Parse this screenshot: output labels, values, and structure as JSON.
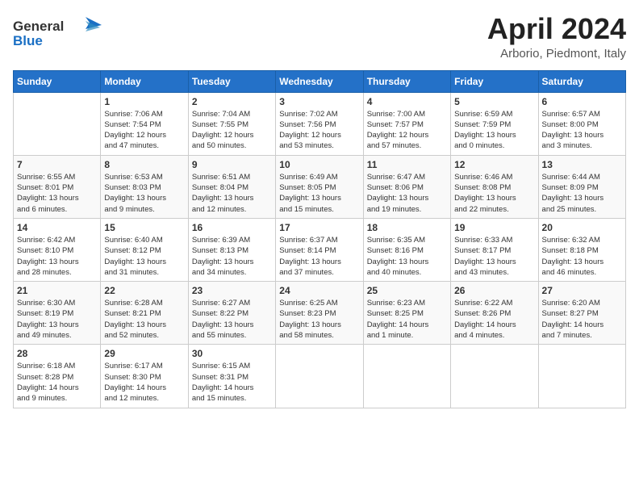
{
  "header": {
    "logo_general": "General",
    "logo_blue": "Blue",
    "title": "April 2024",
    "location": "Arborio, Piedmont, Italy"
  },
  "days_of_week": [
    "Sunday",
    "Monday",
    "Tuesday",
    "Wednesday",
    "Thursday",
    "Friday",
    "Saturday"
  ],
  "weeks": [
    [
      {
        "day": "",
        "info": ""
      },
      {
        "day": "1",
        "info": "Sunrise: 7:06 AM\nSunset: 7:54 PM\nDaylight: 12 hours\nand 47 minutes."
      },
      {
        "day": "2",
        "info": "Sunrise: 7:04 AM\nSunset: 7:55 PM\nDaylight: 12 hours\nand 50 minutes."
      },
      {
        "day": "3",
        "info": "Sunrise: 7:02 AM\nSunset: 7:56 PM\nDaylight: 12 hours\nand 53 minutes."
      },
      {
        "day": "4",
        "info": "Sunrise: 7:00 AM\nSunset: 7:57 PM\nDaylight: 12 hours\nand 57 minutes."
      },
      {
        "day": "5",
        "info": "Sunrise: 6:59 AM\nSunset: 7:59 PM\nDaylight: 13 hours\nand 0 minutes."
      },
      {
        "day": "6",
        "info": "Sunrise: 6:57 AM\nSunset: 8:00 PM\nDaylight: 13 hours\nand 3 minutes."
      }
    ],
    [
      {
        "day": "7",
        "info": "Sunrise: 6:55 AM\nSunset: 8:01 PM\nDaylight: 13 hours\nand 6 minutes."
      },
      {
        "day": "8",
        "info": "Sunrise: 6:53 AM\nSunset: 8:03 PM\nDaylight: 13 hours\nand 9 minutes."
      },
      {
        "day": "9",
        "info": "Sunrise: 6:51 AM\nSunset: 8:04 PM\nDaylight: 13 hours\nand 12 minutes."
      },
      {
        "day": "10",
        "info": "Sunrise: 6:49 AM\nSunset: 8:05 PM\nDaylight: 13 hours\nand 15 minutes."
      },
      {
        "day": "11",
        "info": "Sunrise: 6:47 AM\nSunset: 8:06 PM\nDaylight: 13 hours\nand 19 minutes."
      },
      {
        "day": "12",
        "info": "Sunrise: 6:46 AM\nSunset: 8:08 PM\nDaylight: 13 hours\nand 22 minutes."
      },
      {
        "day": "13",
        "info": "Sunrise: 6:44 AM\nSunset: 8:09 PM\nDaylight: 13 hours\nand 25 minutes."
      }
    ],
    [
      {
        "day": "14",
        "info": "Sunrise: 6:42 AM\nSunset: 8:10 PM\nDaylight: 13 hours\nand 28 minutes."
      },
      {
        "day": "15",
        "info": "Sunrise: 6:40 AM\nSunset: 8:12 PM\nDaylight: 13 hours\nand 31 minutes."
      },
      {
        "day": "16",
        "info": "Sunrise: 6:39 AM\nSunset: 8:13 PM\nDaylight: 13 hours\nand 34 minutes."
      },
      {
        "day": "17",
        "info": "Sunrise: 6:37 AM\nSunset: 8:14 PM\nDaylight: 13 hours\nand 37 minutes."
      },
      {
        "day": "18",
        "info": "Sunrise: 6:35 AM\nSunset: 8:16 PM\nDaylight: 13 hours\nand 40 minutes."
      },
      {
        "day": "19",
        "info": "Sunrise: 6:33 AM\nSunset: 8:17 PM\nDaylight: 13 hours\nand 43 minutes."
      },
      {
        "day": "20",
        "info": "Sunrise: 6:32 AM\nSunset: 8:18 PM\nDaylight: 13 hours\nand 46 minutes."
      }
    ],
    [
      {
        "day": "21",
        "info": "Sunrise: 6:30 AM\nSunset: 8:19 PM\nDaylight: 13 hours\nand 49 minutes."
      },
      {
        "day": "22",
        "info": "Sunrise: 6:28 AM\nSunset: 8:21 PM\nDaylight: 13 hours\nand 52 minutes."
      },
      {
        "day": "23",
        "info": "Sunrise: 6:27 AM\nSunset: 8:22 PM\nDaylight: 13 hours\nand 55 minutes."
      },
      {
        "day": "24",
        "info": "Sunrise: 6:25 AM\nSunset: 8:23 PM\nDaylight: 13 hours\nand 58 minutes."
      },
      {
        "day": "25",
        "info": "Sunrise: 6:23 AM\nSunset: 8:25 PM\nDaylight: 14 hours\nand 1 minute."
      },
      {
        "day": "26",
        "info": "Sunrise: 6:22 AM\nSunset: 8:26 PM\nDaylight: 14 hours\nand 4 minutes."
      },
      {
        "day": "27",
        "info": "Sunrise: 6:20 AM\nSunset: 8:27 PM\nDaylight: 14 hours\nand 7 minutes."
      }
    ],
    [
      {
        "day": "28",
        "info": "Sunrise: 6:18 AM\nSunset: 8:28 PM\nDaylight: 14 hours\nand 9 minutes."
      },
      {
        "day": "29",
        "info": "Sunrise: 6:17 AM\nSunset: 8:30 PM\nDaylight: 14 hours\nand 12 minutes."
      },
      {
        "day": "30",
        "info": "Sunrise: 6:15 AM\nSunset: 8:31 PM\nDaylight: 14 hours\nand 15 minutes."
      },
      {
        "day": "",
        "info": ""
      },
      {
        "day": "",
        "info": ""
      },
      {
        "day": "",
        "info": ""
      },
      {
        "day": "",
        "info": ""
      }
    ]
  ]
}
